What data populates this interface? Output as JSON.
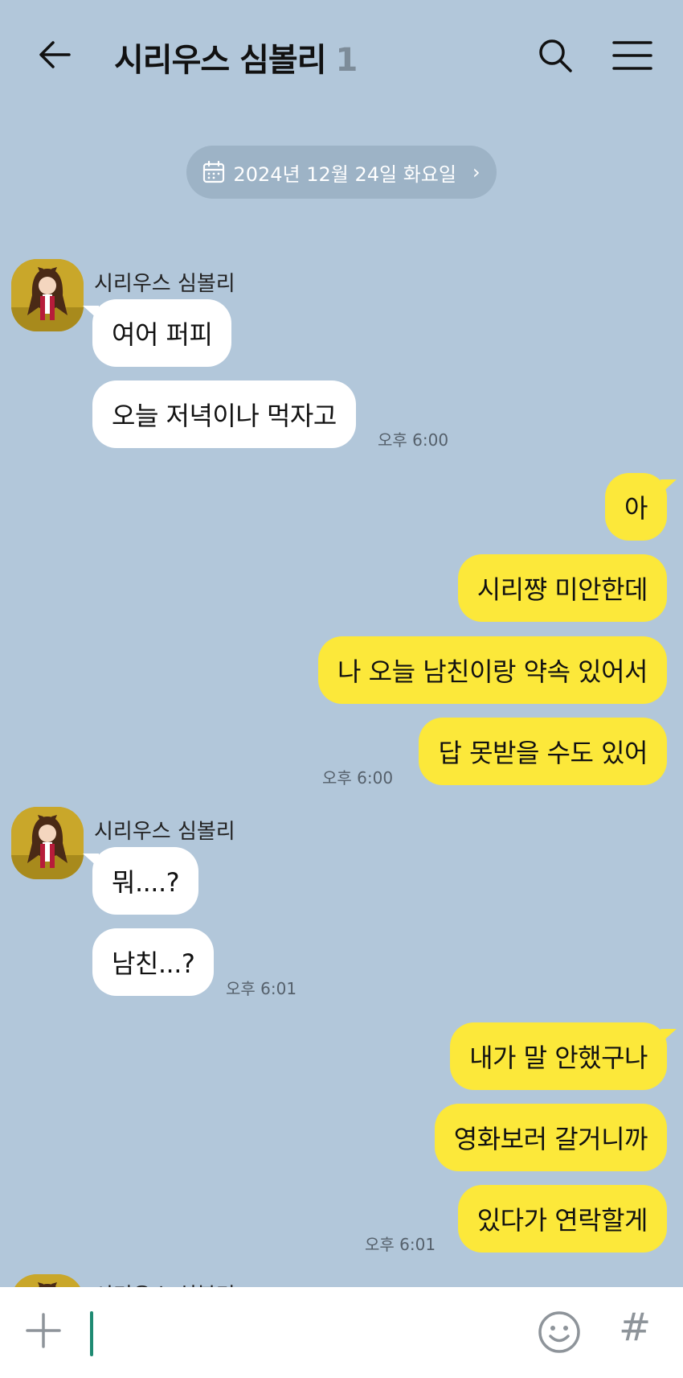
{
  "header": {
    "title": "시리우스 심볼리",
    "member_count": "1"
  },
  "date_divider": {
    "text": "2024년 12월 24일 화요일",
    "chevron": "›"
  },
  "icons": {
    "back": "arrow-left-icon",
    "search": "search-icon",
    "menu": "hamburger-menu-icon",
    "calendar": "calendar-icon",
    "plus": "plus-icon",
    "emoji": "emoji-icon",
    "hash": "#"
  },
  "messages": {
    "group1": {
      "sender": "시리우스 심볼리",
      "lines": [
        "여어 퍼피",
        "오늘 저녁이나 먹자고"
      ],
      "time": "오후 6:00"
    },
    "group2": {
      "lines": [
        "아",
        "시리쨩 미안한데",
        "나 오늘 남친이랑 약속 있어서",
        "답 못받을 수도 있어"
      ],
      "time": "오후 6:00"
    },
    "group3": {
      "sender": "시리우스 심볼리",
      "lines": [
        "뭐....?",
        "남친...?"
      ],
      "time": "오후 6:01"
    },
    "group4": {
      "lines": [
        "내가 말 안했구나",
        "영화보러 갈거니까",
        "있다가 연락할게"
      ],
      "time": "오후 6:01"
    },
    "group5": {
      "sender": "시리우스 심볼리"
    }
  },
  "colors": {
    "background": "#b2c7da",
    "outgoing_bubble": "#fce83a",
    "incoming_bubble": "#ffffff",
    "cursor": "#1f8a72"
  }
}
